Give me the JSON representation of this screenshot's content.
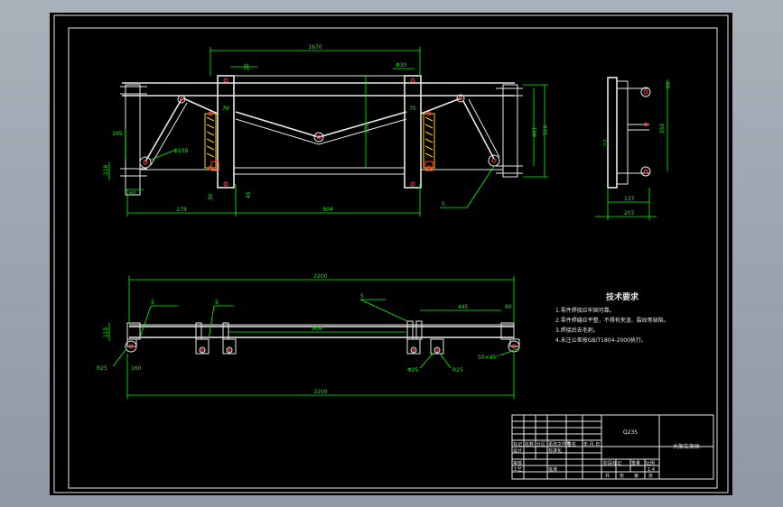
{
  "sheet": {
    "background": "#000000",
    "line_color": "#e8e8e8",
    "dimension_color": "#00ff00",
    "hole_color": "#ff4040",
    "spring_color": "#ffd400"
  },
  "front_view": {
    "dims": {
      "top_overall": "1670",
      "hinge_pin": "20",
      "pin_right": "Φ30",
      "rail_left": "70",
      "rail_right": "70",
      "left_height": "105",
      "left_pivot": "Φ109",
      "left_low": "118",
      "left_offset": "60",
      "inner_height": "350",
      "side_height": "461",
      "side_total": "510",
      "bottom_left": "278",
      "bottom_gap": "45",
      "bottom_mid": "904",
      "bottom_small": "30",
      "weld": "5"
    }
  },
  "side_view": {
    "dims": {
      "top": "60",
      "mid": "350",
      "left": "27",
      "bottom_inner": "137",
      "bottom_outer": "207"
    }
  },
  "plan_view": {
    "dims": {
      "overall_top": "2200",
      "weld_1": "5",
      "weld_2": "5",
      "weld_3": "5",
      "right_seg": "445",
      "right_small": "60",
      "center": "904",
      "left_height": "115",
      "left_radius": "R25",
      "left_offset": "160",
      "chamfer": "50×45°",
      "hole_left": "Φ25",
      "hole_right": "R25",
      "overall_bottom": "2200"
    }
  },
  "technical_requirements": {
    "title": "技术要求",
    "items": [
      "1.零件焊接应牢固可靠。",
      "2.零件焊缝应平整，不得有夹渣、裂纹等缺陷。",
      "3.焊接后去毛刺。",
      "4.未注公差按GB/T1804-2000执行。"
    ]
  },
  "title_block": {
    "material": "Q235",
    "part_name": "大架车架体",
    "row_labels": [
      "标记",
      "处数",
      "分区",
      "更改文件号",
      "签名",
      "年.月.日"
    ],
    "design": "设计",
    "standardize": "标准化",
    "review": "审核",
    "process": "工艺",
    "approve": "批准",
    "stage_mark": "阶段标记",
    "weight": "重量",
    "scale": "比例",
    "scale_value": "1:4",
    "sheet_total": "共",
    "sheet_no": "张",
    "sheet_of": "第"
  }
}
